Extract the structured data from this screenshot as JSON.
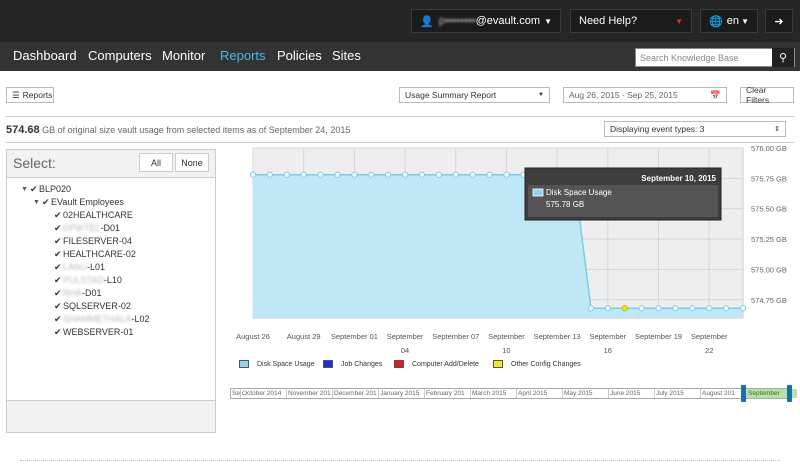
{
  "topbar": {
    "user_prefix": "p••••••••",
    "user_email": "@evault.com",
    "help_label": "Need Help?",
    "lang_label": "en"
  },
  "nav": {
    "items": [
      "Dashboard",
      "Computers",
      "Monitor",
      "Reports",
      "Policies",
      "Sites"
    ],
    "active": "Reports",
    "search_placeholder": "Search Knowledge Base"
  },
  "toolbar": {
    "reports_label": "Reports",
    "report_type": "Usage Summary Report",
    "date_range": "Aug 26, 2015 - Sep 25, 2015",
    "clear_label": "Clear Filters"
  },
  "summary": {
    "value": "574.68",
    "text": "GB of original size vault usage from selected items as of September 24, 2015",
    "event_types": "Displaying event types: 3"
  },
  "select_panel": {
    "title": "Select:",
    "all_label": "All",
    "none_label": "None",
    "tree": [
      {
        "label": "BLP020",
        "level": 0,
        "toggle": true
      },
      {
        "label": "EVault Employees",
        "level": 1,
        "toggle": true
      },
      {
        "label": "02HEALTHCARE",
        "level": 2
      },
      {
        "label": "-D01",
        "blur_prefix": "DPWTEL",
        "level": 2
      },
      {
        "label": "FILESERVER-04",
        "level": 2
      },
      {
        "label": "HEALTHCARE-02",
        "level": 2
      },
      {
        "label": "-L01",
        "blur_prefix": "LANU",
        "level": 2
      },
      {
        "label": "-L10",
        "blur_prefix": "PULSTAD",
        "level": 2
      },
      {
        "label": "-D01",
        "blur_prefix": "RHA",
        "level": 2
      },
      {
        "label": "SQLSERVER-02",
        "level": 2
      },
      {
        "label": "-L02",
        "blur_prefix": "SHAMMETHALA",
        "level": 2
      },
      {
        "label": "WEBSERVER-01",
        "level": 2
      }
    ]
  },
  "chart_data": {
    "type": "area",
    "x": [
      "2015-08-26",
      "2015-08-27",
      "2015-08-28",
      "2015-08-29",
      "2015-08-30",
      "2015-08-31",
      "2015-09-01",
      "2015-09-02",
      "2015-09-03",
      "2015-09-04",
      "2015-09-05",
      "2015-09-06",
      "2015-09-07",
      "2015-09-08",
      "2015-09-09",
      "2015-09-10",
      "2015-09-11",
      "2015-09-12",
      "2015-09-13",
      "2015-09-14",
      "2015-09-15",
      "2015-09-16",
      "2015-09-17",
      "2015-09-18",
      "2015-09-19",
      "2015-09-20",
      "2015-09-21",
      "2015-09-22",
      "2015-09-23",
      "2015-09-24"
    ],
    "series": [
      {
        "name": "Disk Space Usage",
        "color": "#8fd3ef",
        "values": [
          575.78,
          575.78,
          575.78,
          575.78,
          575.78,
          575.78,
          575.78,
          575.78,
          575.78,
          575.78,
          575.78,
          575.78,
          575.78,
          575.78,
          575.78,
          575.78,
          575.78,
          575.78,
          575.78,
          575.78,
          574.68,
          574.68,
          574.68,
          574.68,
          574.68,
          574.68,
          574.68,
          574.68,
          574.68,
          574.68
        ]
      }
    ],
    "event_marker": {
      "date": "2015-09-17",
      "type": "Other Config Changes"
    },
    "x_tick_labels": [
      {
        "date": "2015-08-26",
        "label": "August 26"
      },
      {
        "date": "2015-08-29",
        "label": "August 29"
      },
      {
        "date": "2015-09-01",
        "label": "September 01"
      },
      {
        "date": "2015-09-04",
        "label": "September",
        "sub": "04"
      },
      {
        "date": "2015-09-07",
        "label": "September 07"
      },
      {
        "date": "2015-09-10",
        "label": "September",
        "sub": "10"
      },
      {
        "date": "2015-09-13",
        "label": "September 13"
      },
      {
        "date": "2015-09-16",
        "label": "September",
        "sub": "16"
      },
      {
        "date": "2015-09-19",
        "label": "September 19"
      },
      {
        "date": "2015-09-22",
        "label": "September",
        "sub": "22"
      }
    ],
    "y_ticks": [
      "576.00 GB",
      "575.75 GB",
      "575.50 GB",
      "575.25 GB",
      "575.00 GB",
      "574.75 GB"
    ],
    "y_tick_values": [
      576.0,
      575.75,
      575.5,
      575.25,
      575.0,
      574.75
    ],
    "ylim": [
      574.6,
      576.0
    ],
    "grid": true,
    "tooltip": {
      "date_label": "September 10, 2015",
      "series": "Disk Space Usage",
      "value": "575.78 GB"
    },
    "legend": [
      {
        "label": "Disk Space Usage",
        "color": "#8fd3ef"
      },
      {
        "label": "Job Changes",
        "color": "#1a2fd6"
      },
      {
        "label": "Computer Add/Delete",
        "color": "#e01b24"
      },
      {
        "label": "Other Config Changes",
        "color": "#f2ea1d"
      }
    ]
  },
  "timeline": {
    "months": [
      "Se",
      "October 2014",
      "November 201",
      "December 201",
      "January 2015",
      "February 201",
      "March 2015",
      "April 2015",
      "May 2015",
      "June 2015",
      "July 2015",
      "August 201",
      "September"
    ]
  }
}
